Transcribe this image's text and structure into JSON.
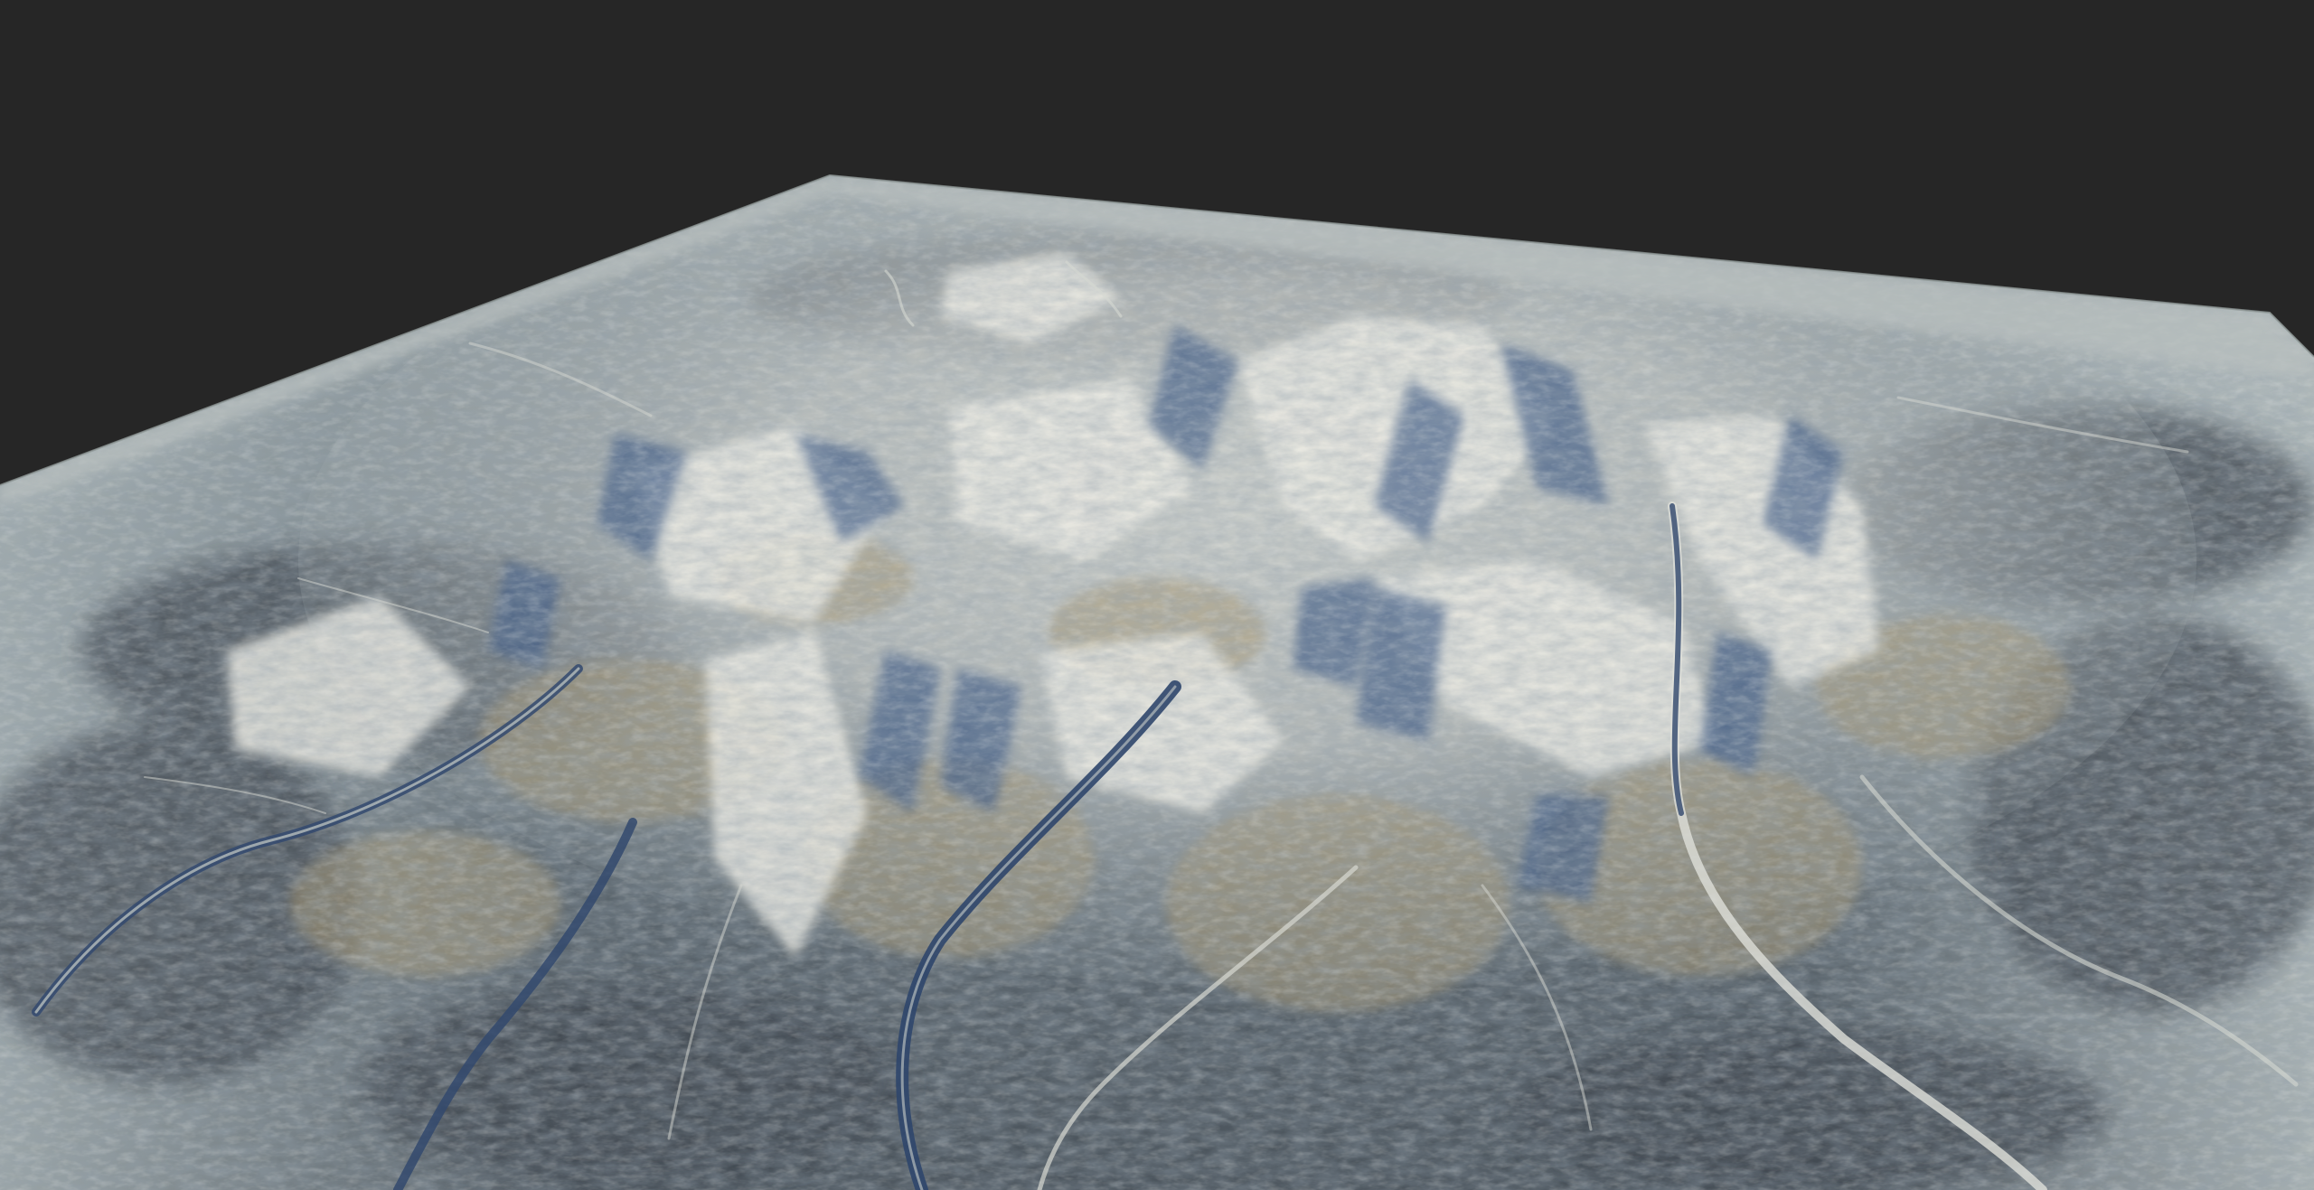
{
  "viewport": {
    "background_color": "#262626"
  },
  "terrain": {
    "description_icon": "terrain-mesh-icon",
    "colors": {
      "plain_light": "#a9b4b6",
      "plain_mid": "#7d8a90",
      "plain_dark": "#4f5961",
      "lowland_dark": "#3d454d",
      "ridge_light": "#d9dcd6",
      "ridge_highlight": "#ecebe3",
      "slope_tan": "#a89a78",
      "shadow_blue": "#3f5b86",
      "shadow_deep": "#2e4468",
      "river_light": "#c9cec9"
    }
  }
}
